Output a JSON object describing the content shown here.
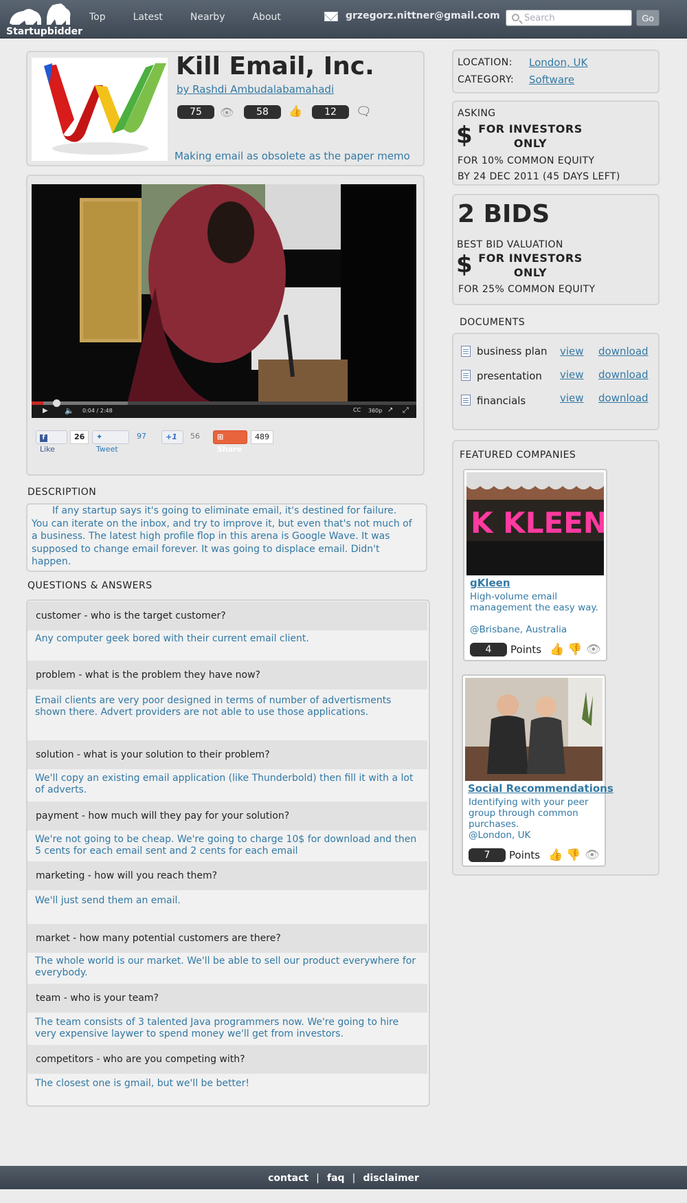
{
  "header": {
    "app_name": "Startupbidder",
    "nav": [
      "Top",
      "Latest",
      "Nearby",
      "About"
    ],
    "user_email": "grzegorz.nittner@gmail.com",
    "search_placeholder": "Search",
    "go_label": "Go"
  },
  "company": {
    "title": "Kill Email, Inc.",
    "author": "by Rashdi Ambudalabamahadi",
    "views": "75",
    "likes": "58",
    "comments": "12",
    "tagline": "Making email as obsolete as the paper memo",
    "stat_icons": [
      "eye-icon",
      "thumbs-up-icon",
      "comment-icon"
    ]
  },
  "video": {
    "time": "0:04 / 2:48",
    "quality": "360p",
    "progress": 0.03,
    "loaded": 0.25
  },
  "social": {
    "like_label": "Like",
    "like_count": "26",
    "tweet_label": "Tweet",
    "tweet_count": "97",
    "plusone_label": "+1",
    "plusone_count": "56",
    "share_label": "Share",
    "share_count": "489"
  },
  "description": {
    "heading": "DESCRIPTION",
    "text": "If any startup says it's going to eliminate email, it's destined for failure. You can iterate on the inbox, and try to improve it, but even that's not much of a business. The latest high profile flop in this arena is Google Wave. It was supposed to change email forever. It was going to displace email. Didn't happen."
  },
  "qa": {
    "heading": "QUESTIONS & ANSWERS",
    "items": [
      {
        "q": "customer - who is the target customer?",
        "a": "Any computer geek bored with their current email client."
      },
      {
        "q": "problem - what is the problem they have now?",
        "a": "Email clients are very poor designed in terms of number of advertisments shown there. Advert providers are not able to use those applications."
      },
      {
        "q": "solution - what is your solution to their problem?",
        "a": "We'll copy an existing email application (like Thunderbold) then fill it with a lot of adverts."
      },
      {
        "q": "payment - how much will they pay for your solution?",
        "a": "We're not going to be cheap. We're going to charge 10$ for download and then 5 cents for each email sent and 2 cents for each email"
      },
      {
        "q": "marketing - how will you reach them?",
        "a": "We'll just send them an email."
      },
      {
        "q": "market - how many potential customers are there?",
        "a": "The whole world is our market. We'll be able to sell our product everywhere for everybody."
      },
      {
        "q": "team - who is your team?",
        "a": "The team consists of 3 talented Java programmers now. We're going to hire very expensive laywer to spend money we'll get from investors."
      },
      {
        "q": "competitors - who are you competing with?",
        "a": "The closest one is gmail, but we'll be better!"
      }
    ]
  },
  "info": {
    "location_label": "LOCATION:",
    "location": "London, UK",
    "category_label": "CATEGORY:",
    "category": "Software"
  },
  "asking": {
    "label": "ASKING",
    "dollar": "$",
    "amount": "FOR INVESTORS ONLY",
    "equity": "FOR 10% COMMON EQUITY",
    "deadline": "BY 24 DEC 2011 (45 DAYS LEFT)"
  },
  "bids": {
    "count": "2 BIDS",
    "best_label": "BEST BID VALUATION",
    "dollar": "$",
    "amount": "FOR INVESTORS ONLY",
    "equity": "FOR 25% COMMON EQUITY"
  },
  "documents": {
    "heading": "DOCUMENTS",
    "view_label": "view",
    "download_label": "download",
    "items": [
      "business plan",
      "presentation",
      "financials"
    ]
  },
  "featured": {
    "heading": "FEATURED COMPANIES",
    "points_label": "Points",
    "companies": [
      {
        "name": "gKleen",
        "desc": "High-volume email management the easy way.",
        "location": "@Brisbane, Australia",
        "points": "4",
        "sign": "K KLEEN"
      },
      {
        "name": "Social Recommendations",
        "desc": "Identifying with your peer group through common purchases.",
        "location": "@London, UK",
        "points": "7"
      }
    ]
  },
  "footer": {
    "links": [
      "contact",
      "faq",
      "disclaimer"
    ],
    "separator": "|"
  }
}
